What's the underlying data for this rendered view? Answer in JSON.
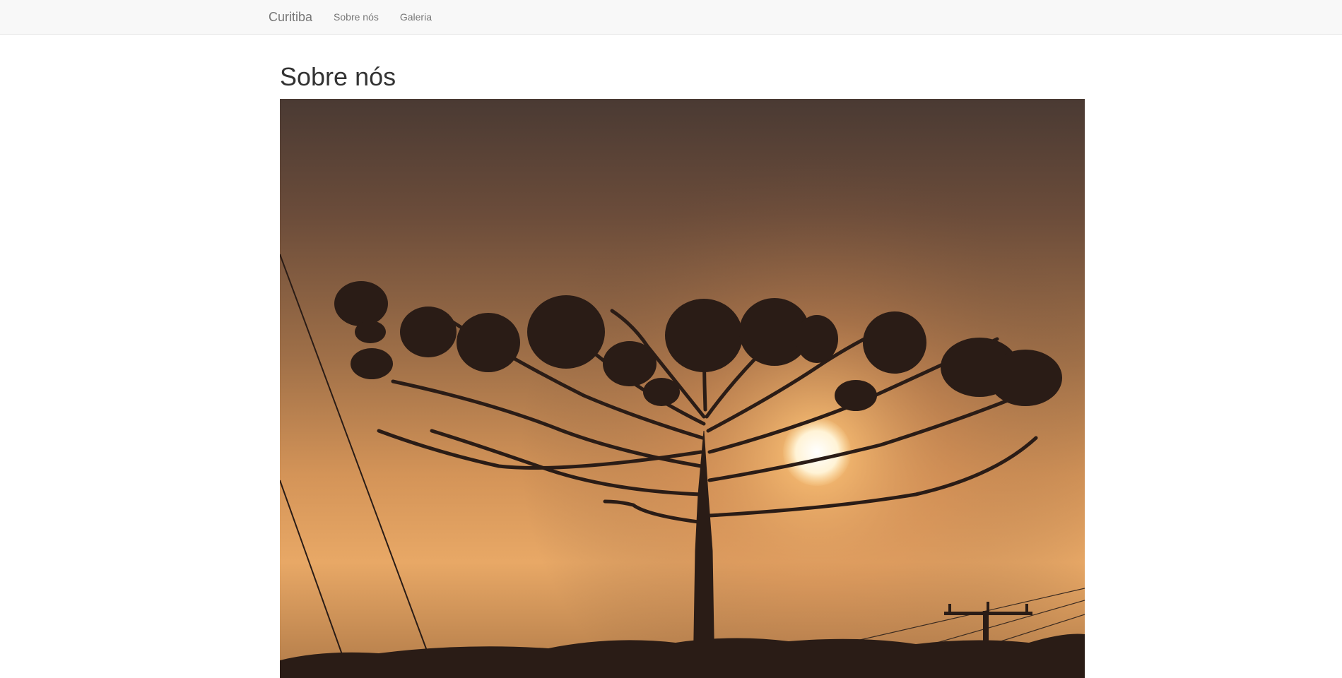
{
  "navbar": {
    "brand": "Curitiba",
    "links": [
      {
        "label": "Sobre nós"
      },
      {
        "label": "Galeria"
      }
    ]
  },
  "main": {
    "title": "Sobre nós",
    "image": {
      "subject": "Araucaria tree silhouette at sunset with power lines",
      "colors": {
        "sky_top": "#4a3a33",
        "sky_mid": "#a07048",
        "sky_glow": "#e8a866",
        "sun": "#fff6e0",
        "silhouette": "#2a1c16"
      }
    }
  }
}
